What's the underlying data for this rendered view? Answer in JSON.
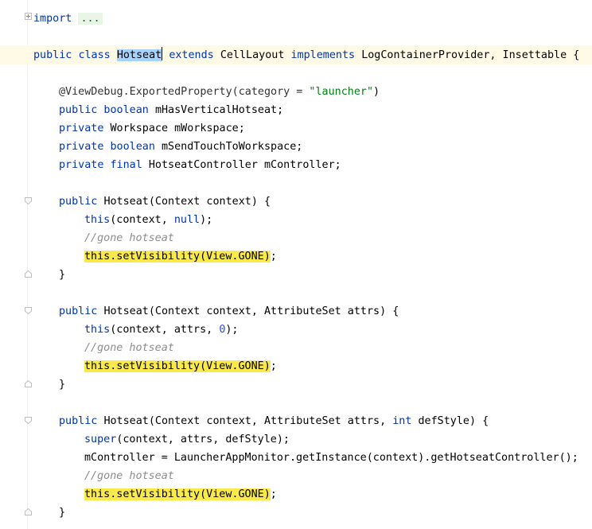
{
  "editor": {
    "lines": {
      "import_kw": "import",
      "import_fold": "...",
      "class_public": "public",
      "class_class": "class",
      "class_name_sel": "Hotseat",
      "class_extends": "extends",
      "class_parent": "CellLayout",
      "class_implements": "implements",
      "class_ifaces": "LogContainerProvider, Insettable {",
      "ann_prefix": "@ViewDebug.ExportedProperty(category = ",
      "ann_str": "\"launcher\"",
      "ann_suffix": ")",
      "f1_mod": "public boolean",
      "f1_name": "mHasVerticalHotseat;",
      "f2_mod": "private",
      "f2_rest": "Workspace mWorkspace;",
      "f3_mod": "private boolean",
      "f3_name": "mSendTouchToWorkspace;",
      "f4_mod": "private final",
      "f4_rest": "HotseatController mController;",
      "c1_mod": "public",
      "c1_sig": "Hotseat(Context context) {",
      "c1_this": "this",
      "c1_args_a": "(context, ",
      "c1_null": "null",
      "c1_args_b": ");",
      "comment": "//gone hotseat",
      "set_vis": "this.setVisibility(View.GONE)",
      "semi": ";",
      "close_brace": "}",
      "c2_mod": "public",
      "c2_sig": "Hotseat(Context context, AttributeSet attrs) {",
      "c2_this": "this",
      "c2_args_a": "(context, attrs, ",
      "c2_zero": "0",
      "c2_args_b": ");",
      "c3_mod": "public",
      "c3_sig_a": "Hotseat(Context context, AttributeSet attrs, ",
      "c3_int": "int",
      "c3_sig_b": " defStyle) {",
      "c3_super": "super",
      "c3_super_args": "(context, attrs, defStyle);",
      "c3_controller": "mController = LauncherAppMonitor.getInstance(context).getHotseatController();"
    }
  },
  "colors": {
    "keyword": "#0033b3",
    "string": "#067d17",
    "number": "#1750eb",
    "comment": "#8c8c8c",
    "highlight": "#f9e94a",
    "selection": "#a6d2ff"
  }
}
